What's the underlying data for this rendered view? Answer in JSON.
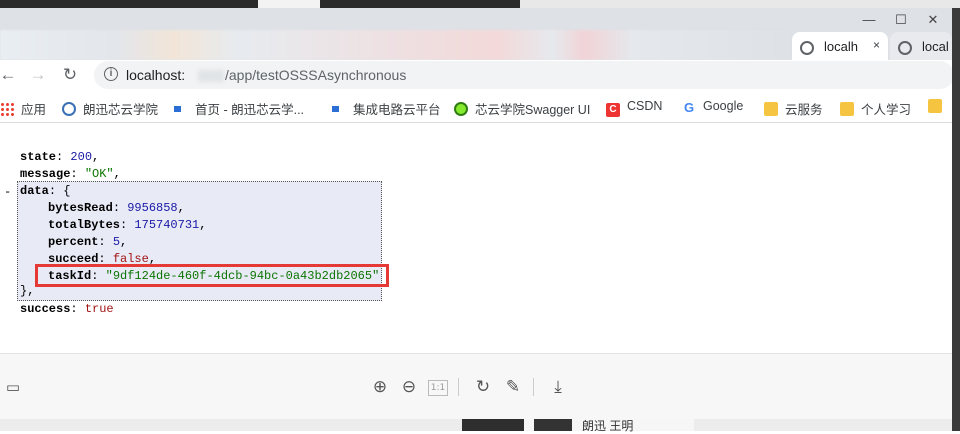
{
  "browser": {
    "tabs": [
      {
        "label": "localh",
        "close": "×"
      },
      {
        "label": "local"
      }
    ],
    "window_controls": {
      "minimize": "—",
      "maximize": "☐",
      "close": "✕"
    }
  },
  "address": {
    "host": "localhost:",
    "path": "/app/testOSSSAsynchronous"
  },
  "bookmarks": [
    {
      "label": "应用",
      "icon": "apps-grid-icon"
    },
    {
      "label": "朗迅芯云学院",
      "icon": "globe-icon"
    },
    {
      "label": "首页 - 朗迅芯云学...",
      "icon": "site-logo-icon"
    },
    {
      "label": "集成电路云平台",
      "icon": "site-logo-icon"
    },
    {
      "label": "芯云学院Swagger UI",
      "icon": "swagger-icon"
    },
    {
      "label": "CSDN",
      "icon": "csdn-icon"
    },
    {
      "label": "Google",
      "icon": "google-icon"
    },
    {
      "label": "云服务",
      "icon": "folder-icon"
    },
    {
      "label": "个人学习",
      "icon": "folder-icon"
    }
  ],
  "json": {
    "state_key": "state",
    "state_val": "200",
    "message_key": "message",
    "message_val": "\"OK\"",
    "data_key": "data",
    "bytesRead_key": "bytesRead",
    "bytesRead_val": "9956858",
    "totalBytes_key": "totalBytes",
    "totalBytes_val": "175740731",
    "percent_key": "percent",
    "percent_val": "5",
    "succeed_key": "succeed",
    "succeed_val": "false",
    "taskId_key": "taskId",
    "taskId_val": "\"9df124de-460f-4dcb-94bc-0a43b2db2065\"",
    "success_key": "success",
    "success_val": "true",
    "collapse": "-"
  },
  "below_text": "朗迅 王明"
}
